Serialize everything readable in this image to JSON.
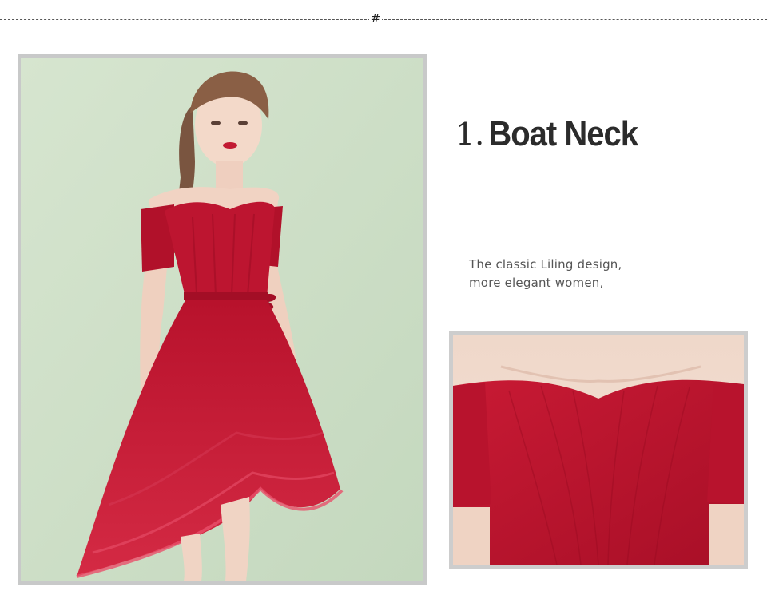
{
  "divider": {
    "mark": "#"
  },
  "heading": {
    "number": "1.",
    "title": "Boat Neck"
  },
  "description": {
    "line1": "The classic Liling design,",
    "line2": "more elegant women,"
  },
  "colors": {
    "dress_red": "#c0152f",
    "background_green": "#cfe0c8",
    "skin": "#f3d9c9",
    "frame_gray": "#c8c9c9",
    "text_dark": "#2b2b2b",
    "text_gray": "#555555"
  }
}
